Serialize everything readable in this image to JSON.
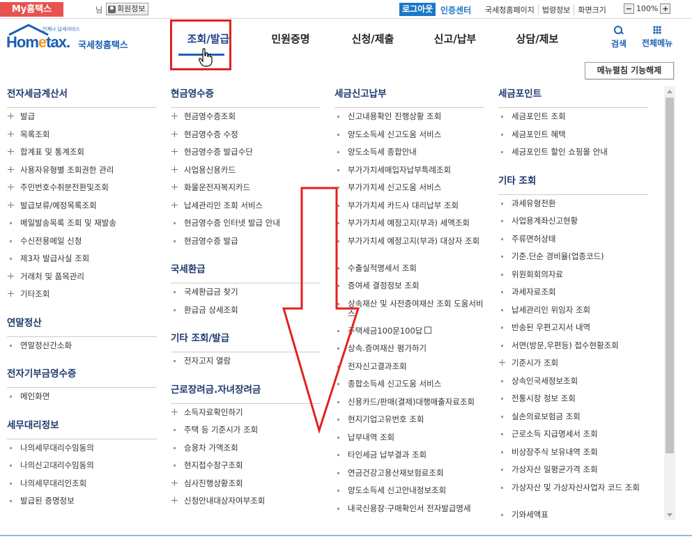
{
  "topbar": {
    "myhome": "My홈택스",
    "nim": "님",
    "member_info": "회원정보",
    "logout": "로그아웃",
    "cert_center": "인증센터",
    "links": [
      "국세청홈페이지",
      "법령정보",
      "화면크기"
    ],
    "zoom_minus": "−",
    "zoom_value": "100%",
    "zoom_plus": "+"
  },
  "header": {
    "logo_small": "언제나 납세서비스",
    "logo_home_a": "Hom",
    "logo_home_e": "e",
    "logo_home_b": "tax.",
    "logo_kr": "국세청홈택스",
    "nav": [
      "조회/발급",
      "민원증명",
      "신청/제출",
      "신고/납부",
      "상담/제보"
    ],
    "search": "검색",
    "all_menu": "전체메뉴"
  },
  "fold_button": "메뉴펼침 기능해제",
  "columns": [
    {
      "sections": [
        {
          "title": "전자세금계산서",
          "items": [
            {
              "m": "plus",
              "t": "발급"
            },
            {
              "m": "plus",
              "t": "목록조회"
            },
            {
              "m": "plus",
              "t": "합계표 및 통계조회"
            },
            {
              "m": "plus",
              "t": "사용자유형별 조회권한 관리"
            },
            {
              "m": "plus",
              "t": "주민번호수취분전환및조회"
            },
            {
              "m": "plus",
              "t": "발급보류/예정목록조회"
            },
            {
              "m": "dot",
              "t": "메일발송목록 조회 및 재발송"
            },
            {
              "m": "dot",
              "t": "수신전용메일 신청"
            },
            {
              "m": "dot",
              "t": "제3자 발급사실 조회"
            },
            {
              "m": "plus",
              "t": "거래처 및 품목관리"
            },
            {
              "m": "plus",
              "t": "기타조회"
            }
          ]
        },
        {
          "title": "연말정산",
          "items": [
            {
              "m": "dot",
              "t": "연말정산간소화"
            }
          ]
        },
        {
          "title": "전자기부금영수증",
          "items": [
            {
              "m": "dot",
              "t": "메인화면"
            }
          ]
        },
        {
          "title": "세무대리정보",
          "items": [
            {
              "m": "dot",
              "t": "나의세무대리수임동의"
            },
            {
              "m": "dot",
              "t": "나의신고대리수임동의"
            },
            {
              "m": "dot",
              "t": "나의세무대리인조회"
            },
            {
              "m": "dot",
              "t": "발급된 증명정보"
            }
          ]
        }
      ]
    },
    {
      "sections": [
        {
          "title": "현금영수증",
          "items": [
            {
              "m": "plus",
              "t": "현금영수증조회"
            },
            {
              "m": "plus",
              "t": "현금영수증 수정"
            },
            {
              "m": "plus",
              "t": "현금영수증 발급수단"
            },
            {
              "m": "plus",
              "t": "사업용신용카드"
            },
            {
              "m": "plus",
              "t": "화물운전자복지카드"
            },
            {
              "m": "plus",
              "t": "납세관리인 조회 서비스"
            },
            {
              "m": "dot",
              "t": "현금영수증 인터넷 발급 안내"
            },
            {
              "m": "dot",
              "t": "현금영수증 발급"
            }
          ]
        },
        {
          "title": "국세환급",
          "items": [
            {
              "m": "dot",
              "t": "국세환급금 찾기"
            },
            {
              "m": "dot",
              "t": "환급금 상세조회"
            }
          ]
        },
        {
          "title": "기타 조회/발급",
          "items": [
            {
              "m": "dot",
              "t": "전자고지 열람"
            }
          ]
        },
        {
          "title": "근로장려금.자녀장려금",
          "items": [
            {
              "m": "plus",
              "t": "소득자료확인하기"
            },
            {
              "m": "dot",
              "t": "주택 등 기준시가 조회"
            },
            {
              "m": "dot",
              "t": "승용차 가액조회"
            },
            {
              "m": "dot",
              "t": "현지접수창구조회"
            },
            {
              "m": "plus",
              "t": "심사진행상황조회"
            },
            {
              "m": "plus",
              "t": "신청안내대상자여부조회"
            }
          ]
        }
      ]
    },
    {
      "sections": [
        {
          "title": "세금신고납부",
          "items": [
            {
              "m": "dot",
              "t": "신고내용확인 진행상황 조회"
            },
            {
              "m": "dot",
              "t": "양도소득세 신고도움 서비스"
            },
            {
              "m": "dot",
              "t": "양도소득세 종합안내"
            },
            {
              "m": "dot",
              "t": "부가가치세매입자납부특례조회"
            },
            {
              "m": "dot",
              "t": "부가가치세 신고도움 서비스"
            },
            {
              "m": "dot",
              "t": "부가가치세 카드사 대리납부 조회"
            },
            {
              "m": "dot",
              "t": "부가가치세 예정고지(부과) 세액조회"
            },
            {
              "m": "dot",
              "t": "부가가치세 예정고지(부과) 대상자 조회",
              "two": true
            },
            {
              "m": "dot",
              "t": "수출실적명세서 조회"
            },
            {
              "m": "dot",
              "t": "증여세 결정정보 조회"
            },
            {
              "m": "dot",
              "t": "상속재산 및 사전증여재산 조회 도움서비스",
              "two": true
            },
            {
              "m": "dot",
              "t": "주택세금100문100답",
              "ext": true
            },
            {
              "m": "dot",
              "t": "상속.증여재산 평가하기"
            },
            {
              "m": "dot",
              "t": "전자신고결과조회"
            },
            {
              "m": "dot",
              "t": "종합소득세 신고도움 서비스"
            },
            {
              "m": "dot",
              "t": "신용카드/판매(결제)대행매출자료조회"
            },
            {
              "m": "dot",
              "t": "현지기업고유번호 조회"
            },
            {
              "m": "dot",
              "t": "납부내역 조회"
            },
            {
              "m": "dot",
              "t": "타인세금 납부결과 조회"
            },
            {
              "m": "dot",
              "t": "연금건강고용산재보험료조회"
            },
            {
              "m": "dot",
              "t": "양도소득세 신고안내정보조회"
            },
            {
              "m": "dot",
              "t": "내국신용장·구매확인서 전자발급명세"
            }
          ]
        }
      ]
    },
    {
      "sections": [
        {
          "title": "세금포인트",
          "items": [
            {
              "m": "dot",
              "t": "세금포인트 조회"
            },
            {
              "m": "dot",
              "t": "세금포인트 혜택"
            },
            {
              "m": "dot",
              "t": "세금포인트 할인 쇼핑몰 안내"
            }
          ]
        },
        {
          "title": "기타 조회",
          "items": [
            {
              "m": "dot",
              "t": "과세유형전환"
            },
            {
              "m": "dot",
              "t": "사업용계좌신고현황"
            },
            {
              "m": "dot",
              "t": "주류면허상태"
            },
            {
              "m": "dot",
              "t": "기준.단순 경비율(업종코드)"
            },
            {
              "m": "dot",
              "t": "위원회회의자료"
            },
            {
              "m": "dot",
              "t": "과세자료조회"
            },
            {
              "m": "dot",
              "t": "납세관리인 위임자 조회"
            },
            {
              "m": "dot",
              "t": "반송된 우편고지서 내역"
            },
            {
              "m": "dot",
              "t": "서면(방문,우편등) 접수현황조회"
            },
            {
              "m": "plus",
              "t": "기준시가 조회"
            },
            {
              "m": "dot",
              "t": "상속인국세정보조회"
            },
            {
              "m": "dot",
              "t": "전통시장 정보 조회"
            },
            {
              "m": "dot",
              "t": "실손의료보험금 조회"
            },
            {
              "m": "dot",
              "t": "근로소득 지급명세서 조회"
            },
            {
              "m": "dot",
              "t": "비상장주식 보유내역 조회"
            },
            {
              "m": "dot",
              "t": "가상자산 일평균가격 조회"
            },
            {
              "m": "dot",
              "t": "가상자산 및 가상자산사업자 코드 조회",
              "two": true
            },
            {
              "m": "dot",
              "t": "기와세액표"
            }
          ]
        }
      ]
    }
  ]
}
